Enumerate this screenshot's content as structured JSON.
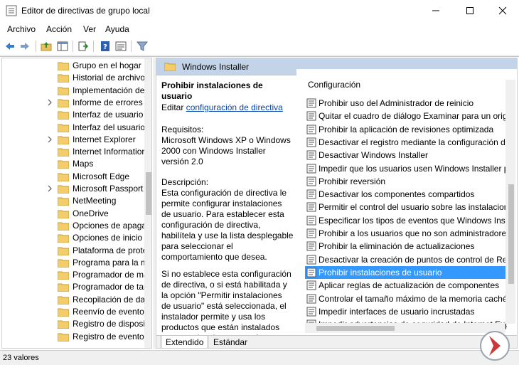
{
  "window": {
    "title": "Editor de directivas de grupo local"
  },
  "menu": [
    "Archivo",
    "Acción",
    "Ver",
    "Ayuda"
  ],
  "tree": {
    "items": [
      {
        "label": "Grupo en el hogar",
        "expandable": false
      },
      {
        "label": "Historial de archivos",
        "expandable": false
      },
      {
        "label": "Implementación de paquetes",
        "expandable": false
      },
      {
        "label": "Informe de errores de Windows",
        "expandable": true
      },
      {
        "label": "Interfaz de usuario de credenciales",
        "expandable": false
      },
      {
        "label": "Interfaz del usuario de Windows",
        "expandable": false
      },
      {
        "label": "Internet Explorer",
        "expandable": true
      },
      {
        "label": "Internet Information Services",
        "expandable": false
      },
      {
        "label": "Maps",
        "expandable": false
      },
      {
        "label": "Microsoft Edge",
        "expandable": false
      },
      {
        "label": "Microsoft Passport",
        "expandable": true
      },
      {
        "label": "NetMeeting",
        "expandable": false
      },
      {
        "label": "OneDrive",
        "expandable": false
      },
      {
        "label": "Opciones de apagado",
        "expandable": false
      },
      {
        "label": "Opciones de inicio de sesión",
        "expandable": false
      },
      {
        "label": "Plataforma de protección",
        "expandable": false
      },
      {
        "label": "Programa para la mejora",
        "expandable": false
      },
      {
        "label": "Programador de mantenimiento",
        "expandable": false
      },
      {
        "label": "Programador de tareas",
        "expandable": false
      },
      {
        "label": "Recopilación de datos",
        "expandable": false
      },
      {
        "label": "Reenvío de eventos",
        "expandable": false
      },
      {
        "label": "Registro de dispositivos",
        "expandable": false
      },
      {
        "label": "Registro de eventos",
        "expandable": false
      }
    ]
  },
  "right": {
    "header": "Windows Installer",
    "desc": {
      "title": "Prohibir instalaciones de usuario",
      "edit_prefix": "Editar",
      "edit_link": "configuración de directiva",
      "req_label": "Requisitos:",
      "req_text": "Microsoft Windows XP o Windows 2000 con Windows Installer versión 2.0",
      "desc_label": "Descripción:",
      "desc_text": "Esta configuración de directiva le permite configurar instalaciones de usuario. Para establecer esta configuración de directiva, habilítela y use la lista desplegable para seleccionar el comportamiento que desea.",
      "desc_text2": "Si no establece esta configuración de directiva, o si está habilitada y la opción \"Permitir instalaciones de usuario\" está seleccionada, el instalador permite y usa los productos que están instalados por usuario y los que están"
    },
    "list_header": "Configuración",
    "rows": [
      "Prohibir uso del Administrador de reinicio",
      "Quitar el cuadro de diálogo Examinar para un origen nuevo",
      "Prohibir la aplicación de revisiones optimizada",
      "Desactivar el registro mediante la configuración de usuario",
      "Desactivar Windows Installer",
      "Impedir que los usuarios usen Windows Installer para instalar",
      "Prohibir reversión",
      "Desactivar los componentes compartidos",
      "Permitir el control del usuario sobre las instalaciones",
      "Especificar los tipos de eventos que Windows Installer registra",
      "Prohibir a los usuarios que no son administradores la aplicación",
      "Prohibir la eliminación de actualizaciones",
      "Desactivar la creación de puntos de control de Restaurar sistema",
      "Prohibir instalaciones de usuario",
      "Aplicar reglas de actualización de componentes",
      "Controlar el tamaño máximo de la memoria caché",
      "Impedir interfaces de usuario incrustadas",
      "Impedir advertencias de seguridad de Internet Explorer"
    ],
    "selected_index": 13,
    "tabs": [
      "Extendido",
      "Estándar"
    ],
    "active_tab": 0
  },
  "status": {
    "text": "23 valores"
  },
  "colors": {
    "selection": "#3399ff",
    "header_band": "#c3d4e8",
    "link": "#0645ad"
  }
}
